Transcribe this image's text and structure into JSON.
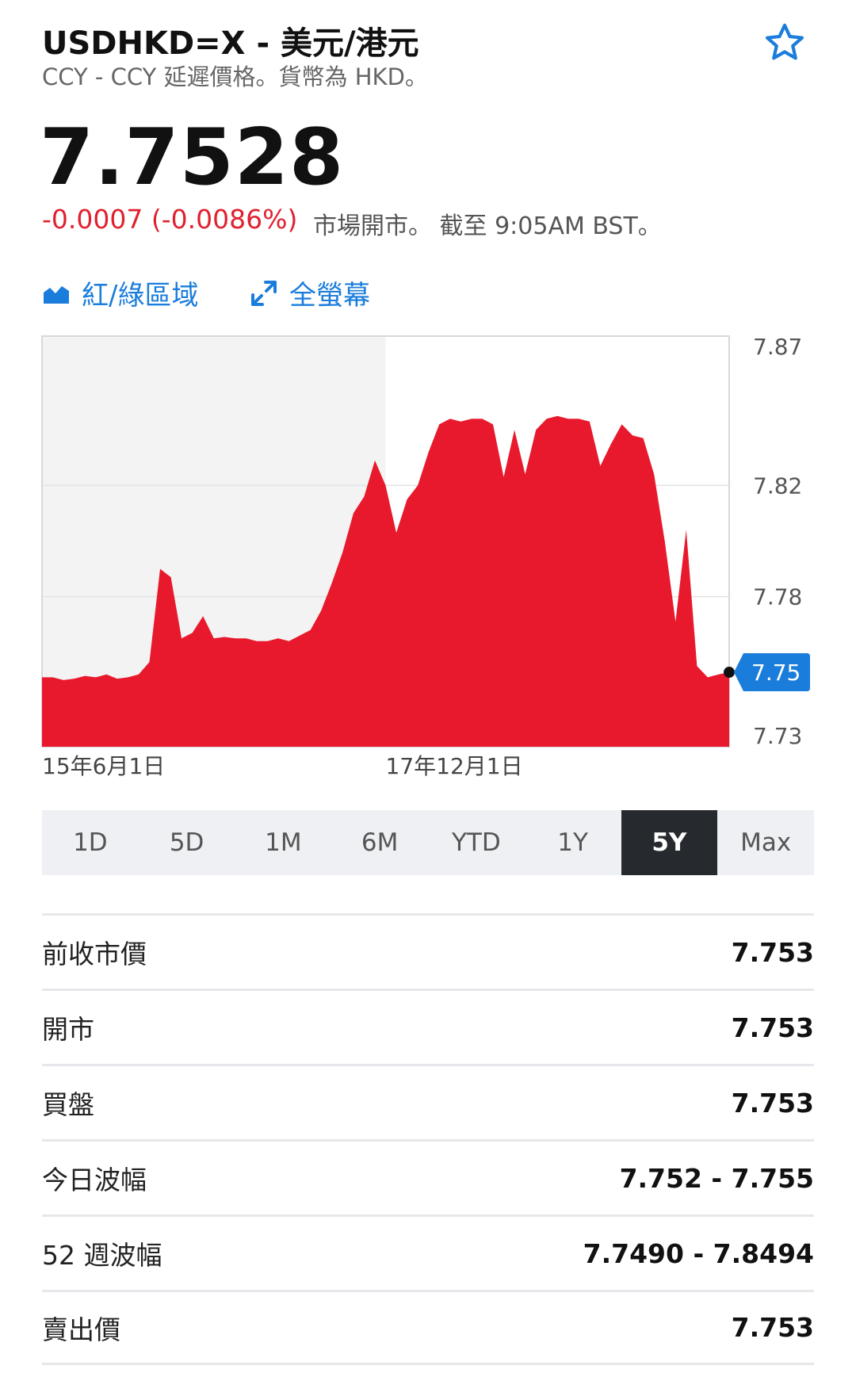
{
  "header": {
    "symbol": "USDHKD=X - 美元/港元",
    "subtitle": "CCY - CCY 延遲價格。貨幣為 HKD。",
    "star_icon": "star-outline-icon"
  },
  "quote": {
    "price": "7.7528",
    "change": "-0.0007 (-0.0086%)",
    "market_status": "市場開市。 截至 9:05AM BST。",
    "change_color": "#e0202f"
  },
  "chart_controls": {
    "area_label": "紅/綠區域",
    "fullscreen_label": "全螢幕",
    "accent_color": "#1b7ddb"
  },
  "chart_data": {
    "type": "area",
    "series": [
      {
        "values": [
          7.751,
          7.751,
          7.75,
          7.7505,
          7.7515,
          7.751,
          7.752,
          7.7505,
          7.751,
          7.752,
          7.7565,
          7.79,
          7.787,
          7.765,
          7.767,
          7.773,
          7.765,
          7.7655,
          7.765,
          7.765,
          7.764,
          7.764,
          7.765,
          7.764,
          7.766,
          7.768,
          7.775,
          7.785,
          7.796,
          7.81,
          7.816,
          7.829,
          7.82,
          7.803,
          7.815,
          7.82,
          7.832,
          7.842,
          7.844,
          7.843,
          7.844,
          7.844,
          7.842,
          7.823,
          7.84,
          7.824,
          7.84,
          7.844,
          7.845,
          7.844,
          7.844,
          7.843,
          7.827,
          7.835,
          7.842,
          7.838,
          7.837,
          7.824,
          7.8,
          7.771,
          7.804,
          7.755,
          7.751,
          7.752,
          7.7528
        ]
      }
    ],
    "y_ticks": [
      "7.87",
      "7.82",
      "7.78",
      "7.75",
      "7.73"
    ],
    "x_labels": [
      "15年6月1日",
      "17年12月1日"
    ],
    "last_value_label": "7.75",
    "fill_color": "#e8192c",
    "grid": true
  },
  "ranges": {
    "tabs": [
      "1D",
      "5D",
      "1M",
      "6M",
      "YTD",
      "1Y",
      "5Y",
      "Max"
    ],
    "active": "5Y"
  },
  "stats": [
    {
      "label": "前收市價",
      "value": "7.753"
    },
    {
      "label": "開市",
      "value": "7.753"
    },
    {
      "label": "買盤",
      "value": "7.753"
    },
    {
      "label": "今日波幅",
      "value": "7.752 - 7.755"
    },
    {
      "label": "52 週波幅",
      "value": "7.7490 - 7.8494"
    },
    {
      "label": "賣出價",
      "value": "7.753"
    }
  ]
}
